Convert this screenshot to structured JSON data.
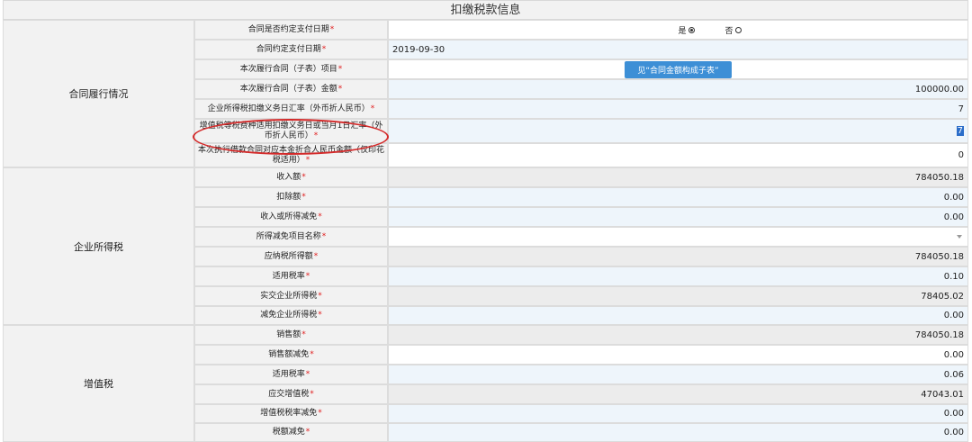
{
  "title": "扣缴税款信息",
  "groups": {
    "contract": "合同履行情况",
    "income_tax": "企业所得税",
    "vat": "增值税"
  },
  "rows": [
    {
      "label": "合同是否约定支付日期",
      "required": "*"
    },
    {
      "label": "合同约定支付日期",
      "required": "*",
      "value": "2019-09-30"
    },
    {
      "label": "本次履行合同（子表）项目",
      "required": "*",
      "value": "见“合同金额构成子表”"
    },
    {
      "label": "本次履行合同（子表）金额",
      "required": "*",
      "value": "100000.00"
    },
    {
      "label": "企业所得税扣缴义务日汇率（外币折人民币）",
      "required": "*",
      "value": "7"
    },
    {
      "label": "增值税等税费种适用扣缴义务日或当月1日汇率（外币折人民币）",
      "required": "*",
      "value": "7"
    },
    {
      "label": "本次执行借款合同对应本金折合人民币金额（仅印花税适用）",
      "required": "*",
      "value": "0"
    },
    {
      "label": "收入额",
      "required": "*",
      "value": "784050.18"
    },
    {
      "label": "扣除额",
      "required": "*",
      "value": "0.00"
    },
    {
      "label": "收入或所得减免",
      "required": "*",
      "value": "0.00"
    },
    {
      "label": "所得减免项目名称",
      "required": "*",
      "value": ""
    },
    {
      "label": "应纳税所得额",
      "required": "*",
      "value": "784050.18"
    },
    {
      "label": "适用税率",
      "required": "*",
      "value": "0.10"
    },
    {
      "label": "实交企业所得税",
      "required": "*",
      "value": "78405.02"
    },
    {
      "label": "减免企业所得税",
      "required": "*",
      "value": "0.00"
    },
    {
      "label": "销售额",
      "required": "*",
      "value": "784050.18"
    },
    {
      "label": "销售额减免",
      "required": "*",
      "value": "0.00"
    },
    {
      "label": "适用税率",
      "required": "*",
      "value": "0.06"
    },
    {
      "label": "应交增值税",
      "required": "*",
      "value": "47043.01"
    },
    {
      "label": "增值税税率减免",
      "required": "*",
      "value": "0.00"
    },
    {
      "label": "税额减免",
      "required": "*",
      "value": "0.00"
    }
  ],
  "radio": {
    "yes": "是",
    "no": "否",
    "selected": "是"
  },
  "colors": {
    "accent": "#3d8fd6",
    "required": "#e02020",
    "annotation": "#d42a2a"
  }
}
